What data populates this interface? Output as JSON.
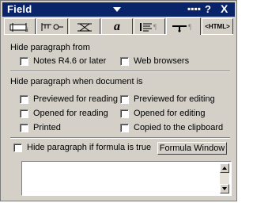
{
  "window": {
    "title": "Field",
    "title_controls": {
      "dots": "▪▪▪▪",
      "help": "?",
      "close": "X"
    }
  },
  "tabs": [
    {
      "name": "field-info",
      "icon": "field-box-icon"
    },
    {
      "name": "paragraph-keys",
      "icon": "key-icon"
    },
    {
      "name": "hyphenation",
      "icon": "pen-icon"
    },
    {
      "name": "font",
      "icon": "font-icon",
      "label": "a"
    },
    {
      "name": "paragraph-alignment",
      "icon": "alignment-icon"
    },
    {
      "name": "hide-when",
      "icon": "hide-paragraph-icon",
      "active": true
    },
    {
      "name": "html",
      "icon": "html-icon",
      "label": "<HTML>"
    }
  ],
  "hide_from": {
    "label": "Hide paragraph from",
    "options": [
      "Notes R4.6 or later",
      "Web browsers"
    ]
  },
  "hide_when": {
    "label": "Hide paragraph when document is",
    "left": [
      "Previewed for reading",
      "Opened for reading",
      "Printed"
    ],
    "right": [
      "Previewed for editing",
      "Opened for editing",
      "Copied to the clipboard"
    ]
  },
  "formula": {
    "checkbox_label": "Hide paragraph if formula is true",
    "button_label": "Formula Window",
    "value": ""
  },
  "colors": {
    "title_bar": "#0a246a",
    "face": "#d4d0c8"
  }
}
